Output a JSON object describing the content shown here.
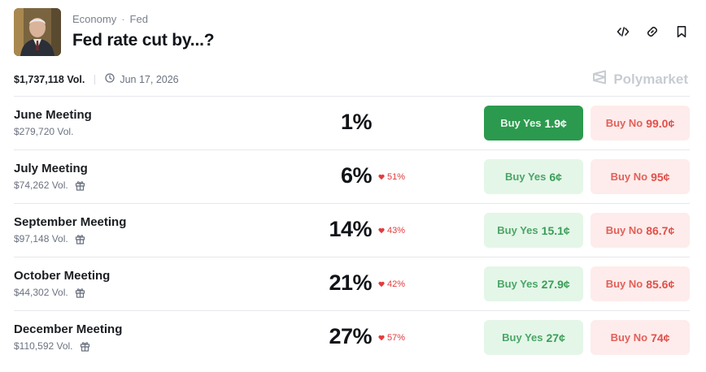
{
  "header": {
    "category": "Economy",
    "subcategory": "Fed",
    "title": "Fed rate cut by...?",
    "actions": [
      {
        "name": "embed-icon"
      },
      {
        "name": "link-icon"
      },
      {
        "name": "bookmark-icon"
      }
    ]
  },
  "meta": {
    "volume": "$1,737,118 Vol.",
    "date": "Jun 17, 2026",
    "brand": "Polymarket"
  },
  "colors": {
    "yes_active": "#2b9a4e",
    "yes_bg": "#e4f6e8",
    "yes_text": "#3a9d58",
    "no_bg": "#fdeceb",
    "no_text": "#e0504b",
    "change_down": "#e03c3c"
  },
  "markets": [
    {
      "name": "June Meeting",
      "volume": "$279,720 Vol.",
      "gift": false,
      "chance": "1%",
      "change": "",
      "yes_label": "Buy Yes",
      "yes_price": "1.9¢",
      "no_label": "Buy No",
      "no_price": "99.0¢",
      "yes_active": true
    },
    {
      "name": "July Meeting",
      "volume": "$74,262 Vol.",
      "gift": true,
      "chance": "6%",
      "change": "51%",
      "yes_label": "Buy Yes",
      "yes_price": "6¢",
      "no_label": "Buy No",
      "no_price": "95¢",
      "yes_active": false
    },
    {
      "name": "September Meeting",
      "volume": "$97,148 Vol.",
      "gift": true,
      "chance": "14%",
      "change": "43%",
      "yes_label": "Buy Yes",
      "yes_price": "15.1¢",
      "no_label": "Buy No",
      "no_price": "86.7¢",
      "yes_active": false
    },
    {
      "name": "October Meeting",
      "volume": "$44,302 Vol.",
      "gift": true,
      "chance": "21%",
      "change": "42%",
      "yes_label": "Buy Yes",
      "yes_price": "27.9¢",
      "no_label": "Buy No",
      "no_price": "85.6¢",
      "yes_active": false
    },
    {
      "name": "December Meeting",
      "volume": "$110,592 Vol.",
      "gift": true,
      "chance": "27%",
      "change": "57%",
      "yes_label": "Buy Yes",
      "yes_price": "27¢",
      "no_label": "Buy No",
      "no_price": "74¢",
      "yes_active": false
    }
  ]
}
